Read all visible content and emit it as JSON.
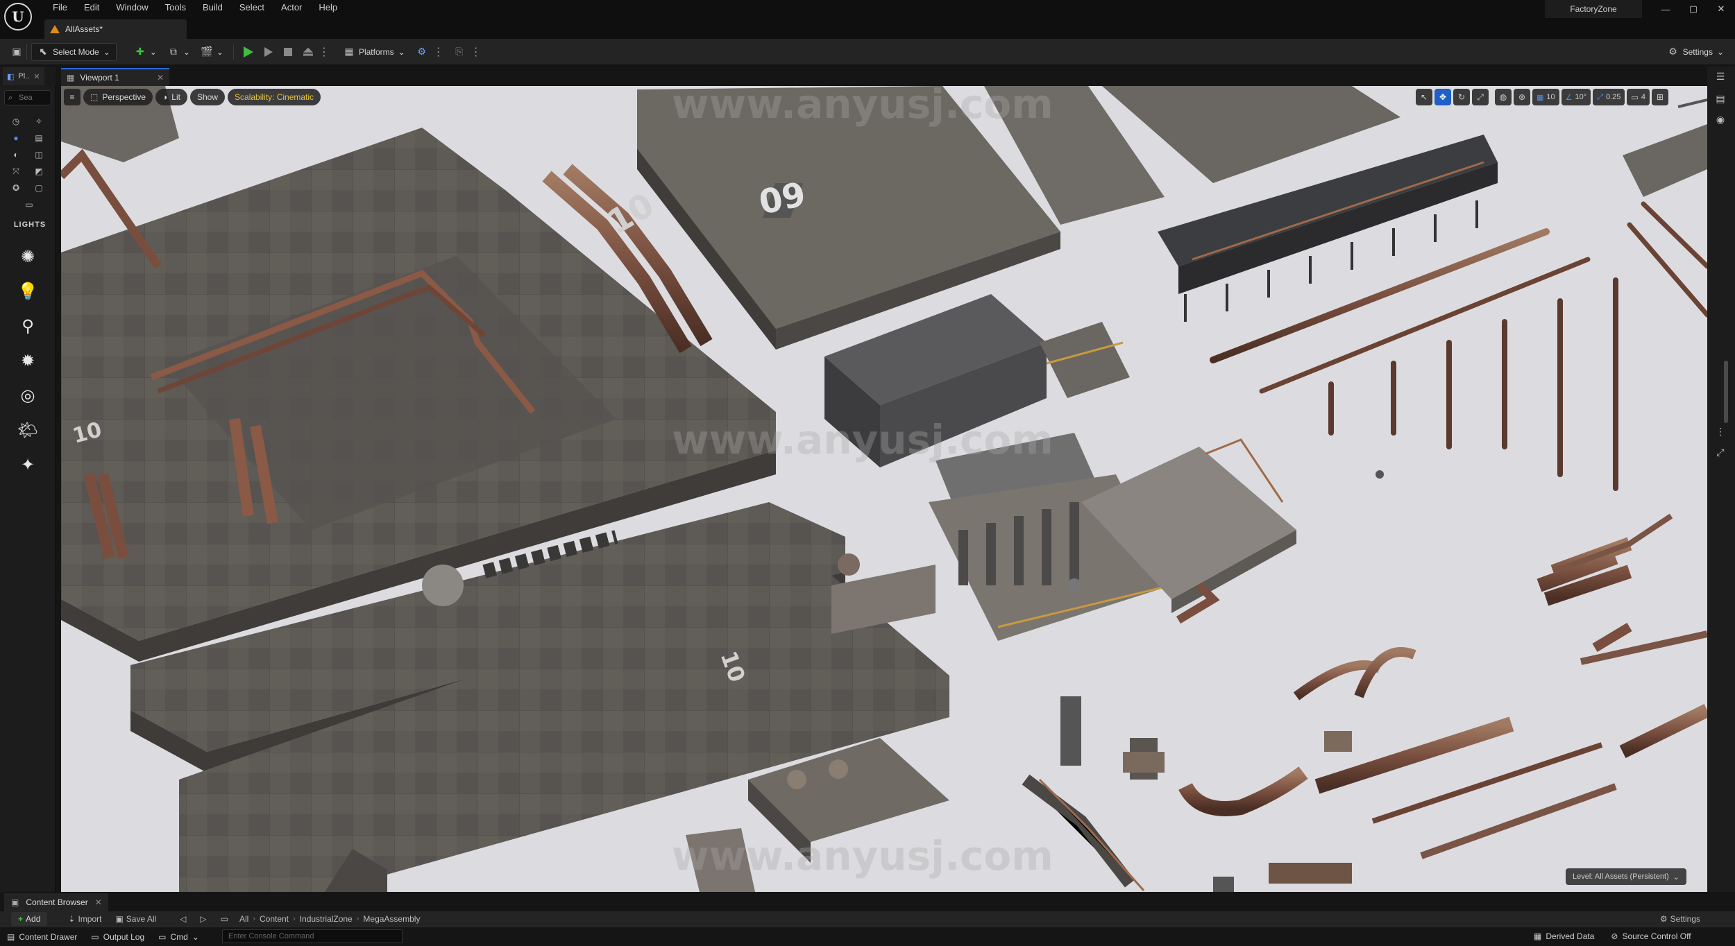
{
  "app": {
    "project_name": "FactoryZone",
    "level_tab": "AllAssets*",
    "logo_glyph": "U"
  },
  "menu": [
    "File",
    "Edit",
    "Window",
    "Tools",
    "Build",
    "Select",
    "Actor",
    "Help"
  ],
  "window_controls": {
    "minimize": "—",
    "maximize": "▢",
    "close": "✕"
  },
  "toolbar": {
    "select_mode": "Select Mode",
    "platforms": "Platforms",
    "settings": "Settings"
  },
  "left_panel": {
    "tab_label": "Pl..",
    "search_placeholder": "Sea",
    "section_lights": "LIGHTS",
    "light_icons": [
      "directional-light-icon",
      "point-light-icon",
      "spot-light-icon",
      "rect-light-icon",
      "sky-light-icon",
      "sky-atmosphere-icon",
      "exponential-fog-icon"
    ]
  },
  "viewport": {
    "tab_label": "Viewport 1",
    "perspective": "Perspective",
    "lit": "Lit",
    "show": "Show",
    "scalability": "Scalability: Cinematic",
    "grid_snap": "10",
    "rotate_snap": "10°",
    "scale_snap": "0.25",
    "camera_speed": "4",
    "level_status": "Level: All Assets (Persistent)",
    "watermark": "www.anyusj.com",
    "floor_labels": [
      "09",
      "10",
      "10",
      "10"
    ]
  },
  "content_browser": {
    "tab_label": "Content Browser",
    "add": "Add",
    "import": "Import",
    "save_all": "Save All",
    "breadcrumbs": [
      "All",
      "Content",
      "IndustrialZone",
      "MegaAssembly"
    ],
    "settings": "Settings"
  },
  "statusbar": {
    "content_drawer": "Content Drawer",
    "output_log": "Output Log",
    "cmd": "Cmd",
    "console_placeholder": "Enter Console Command",
    "derived_data": "Derived Data",
    "source_control": "Source Control Off"
  },
  "colors": {
    "accent_blue": "#2a6ad8",
    "play_green": "#3fbf3f",
    "scalability_yellow": "#e6c140",
    "level_tab_orange": "#d98c1f",
    "viewport_floor": "#dedee2"
  }
}
